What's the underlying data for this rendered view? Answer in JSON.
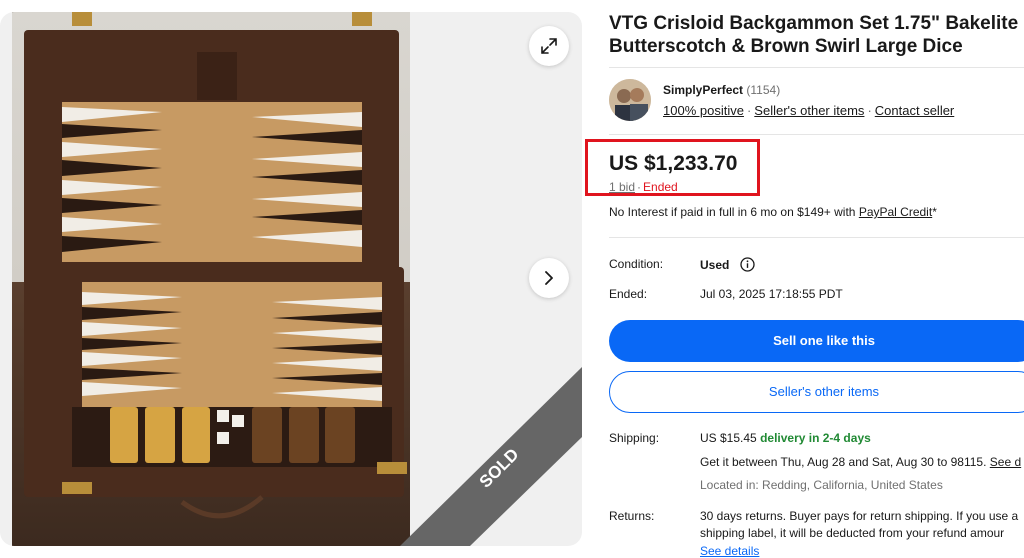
{
  "listing": {
    "title": "VTG Crisloid Backgammon Set 1.75\" Bakelite Butterscotch & Brown Swirl Large Dice"
  },
  "gallery": {
    "sold_label": "SOLD",
    "expand_icon": "expand-icon",
    "next_icon": "chevron-right-icon"
  },
  "seller": {
    "name": "SimplyPerfect",
    "feedback_count": "(1154)",
    "positive": "100% positive",
    "other_items": "Seller's other items",
    "contact": "Contact seller"
  },
  "price": {
    "amount": "US $1,233.70",
    "bids": "1 bid",
    "separator": "·",
    "status": "Ended"
  },
  "financing": {
    "text": "No Interest if paid in full in 6 mo on $149+ with ",
    "link": "PayPal Credit",
    "suffix": "*"
  },
  "details": {
    "condition_label": "Condition:",
    "condition_value": "Used",
    "ended_label": "Ended:",
    "ended_value": "Jul 03, 2025 17:18:55 PDT"
  },
  "actions": {
    "sell_one": "Sell one like this",
    "sellers_other_items": "Seller's other items"
  },
  "shipping": {
    "label": "Shipping:",
    "cost": "US $15.45",
    "delivery": "delivery in 2-4 days",
    "estimate": "Get it between Thu, Aug 28 and Sat, Aug 30 to 98115.",
    "see_link": "See d",
    "location": "Located in: Redding, California, United States"
  },
  "returns": {
    "label": "Returns:",
    "line1": "30 days returns. Buyer pays for return shipping. If you use a",
    "line2": "shipping label, it will be deducted from your refund amour",
    "see_details": "See details"
  },
  "colors": {
    "accent_blue": "#0968f6",
    "ended_red": "#e0141e",
    "delivery_green": "#218a34",
    "highlight_box": "#e0141e"
  }
}
